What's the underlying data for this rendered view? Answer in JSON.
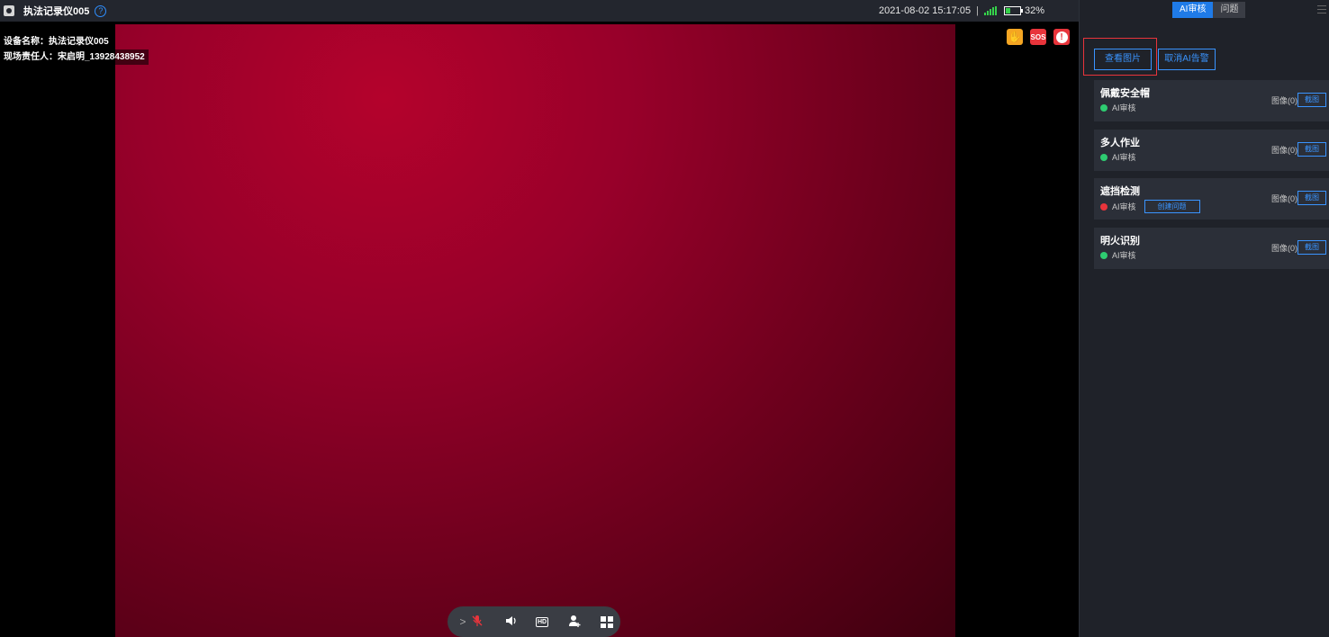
{
  "topbar": {
    "device_title": "执法记录仪005",
    "datetime": "2021-08-02 15:17:05",
    "separator": "|",
    "battery": "32%",
    "battery_level": 0.32
  },
  "overlay": {
    "device_name": "设备名称：执法记录仪005",
    "responsible": "现场责任人：宋启明_13928438952"
  },
  "alerts": {
    "sos": "SOS",
    "exclaim": "!"
  },
  "controls": {
    "expand": ">",
    "hd": "HD"
  },
  "panel": {
    "tabs": [
      "AI审核",
      "问题"
    ],
    "view_btn": "查看图片",
    "cancel_btn": "取消AI告警",
    "cards": [
      {
        "title": "佩戴安全帽",
        "status": "AI审核",
        "status_color": "#2ecc71",
        "images": "图像(0)",
        "shot": "截图"
      },
      {
        "title": "多人作业",
        "status": "AI审核",
        "status_color": "#2ecc71",
        "images": "图像(0)",
        "shot": "截图"
      },
      {
        "title": "遮挡检测",
        "status": "AI审核",
        "status_color": "#e8343b",
        "create": "创建问题",
        "images": "图像(0)",
        "shot": "截图"
      },
      {
        "title": "明火识别",
        "status": "AI审核",
        "status_color": "#2ecc71",
        "images": "图像(0)",
        "shot": "截图"
      }
    ]
  }
}
